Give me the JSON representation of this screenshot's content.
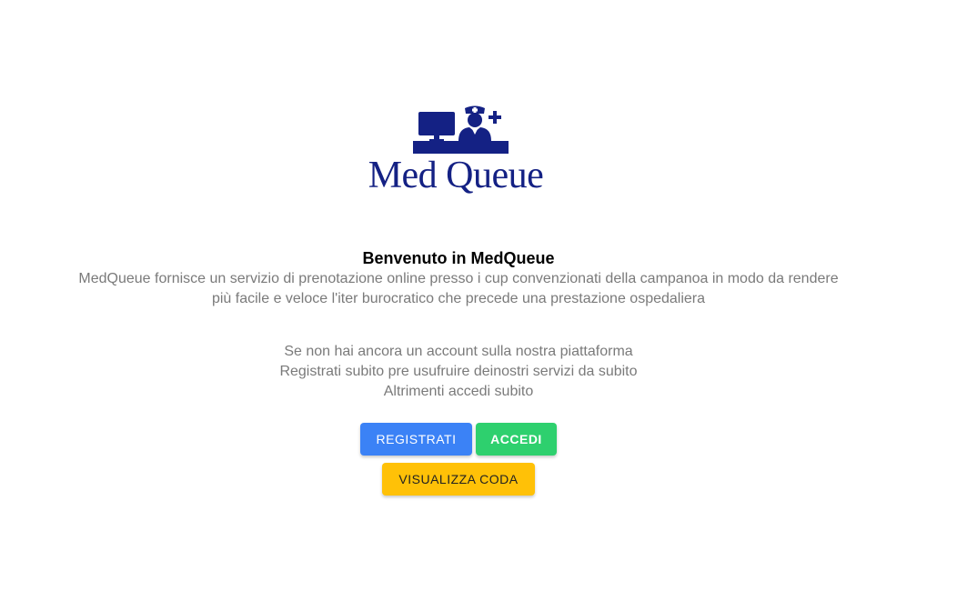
{
  "brand": {
    "name": "MedQueue",
    "logo_text": "Med Queue",
    "color": "#142184"
  },
  "welcome": {
    "title": "Benvenuto in MedQueue",
    "description_line1": "MedQueue fornisce un servizio di prenotazione online presso i cup convenzionati della campanoa in modo da rendere",
    "description_line2": "più facile e veloce l'iter burocratico che precede una prestazione ospedaliera"
  },
  "call_to_action": {
    "line1": "Se non hai ancora un account sulla nostra piattaforma",
    "line2": "Registrati subito pre usufruire deinostri servizi da subito",
    "line3": "Altrimenti accedi subito"
  },
  "buttons": {
    "register_label": "Registrati",
    "login_label": "Accedi",
    "queue_label": "Visualizza coda"
  },
  "colors": {
    "register": "#3b82f6",
    "login": "#2ed06e",
    "queue": "#ffc107",
    "muted_text": "#7a7a7a"
  },
  "icons": [
    "computer-monitor-icon",
    "nurse-icon",
    "medical-cross-icon",
    "desk-icon"
  ]
}
